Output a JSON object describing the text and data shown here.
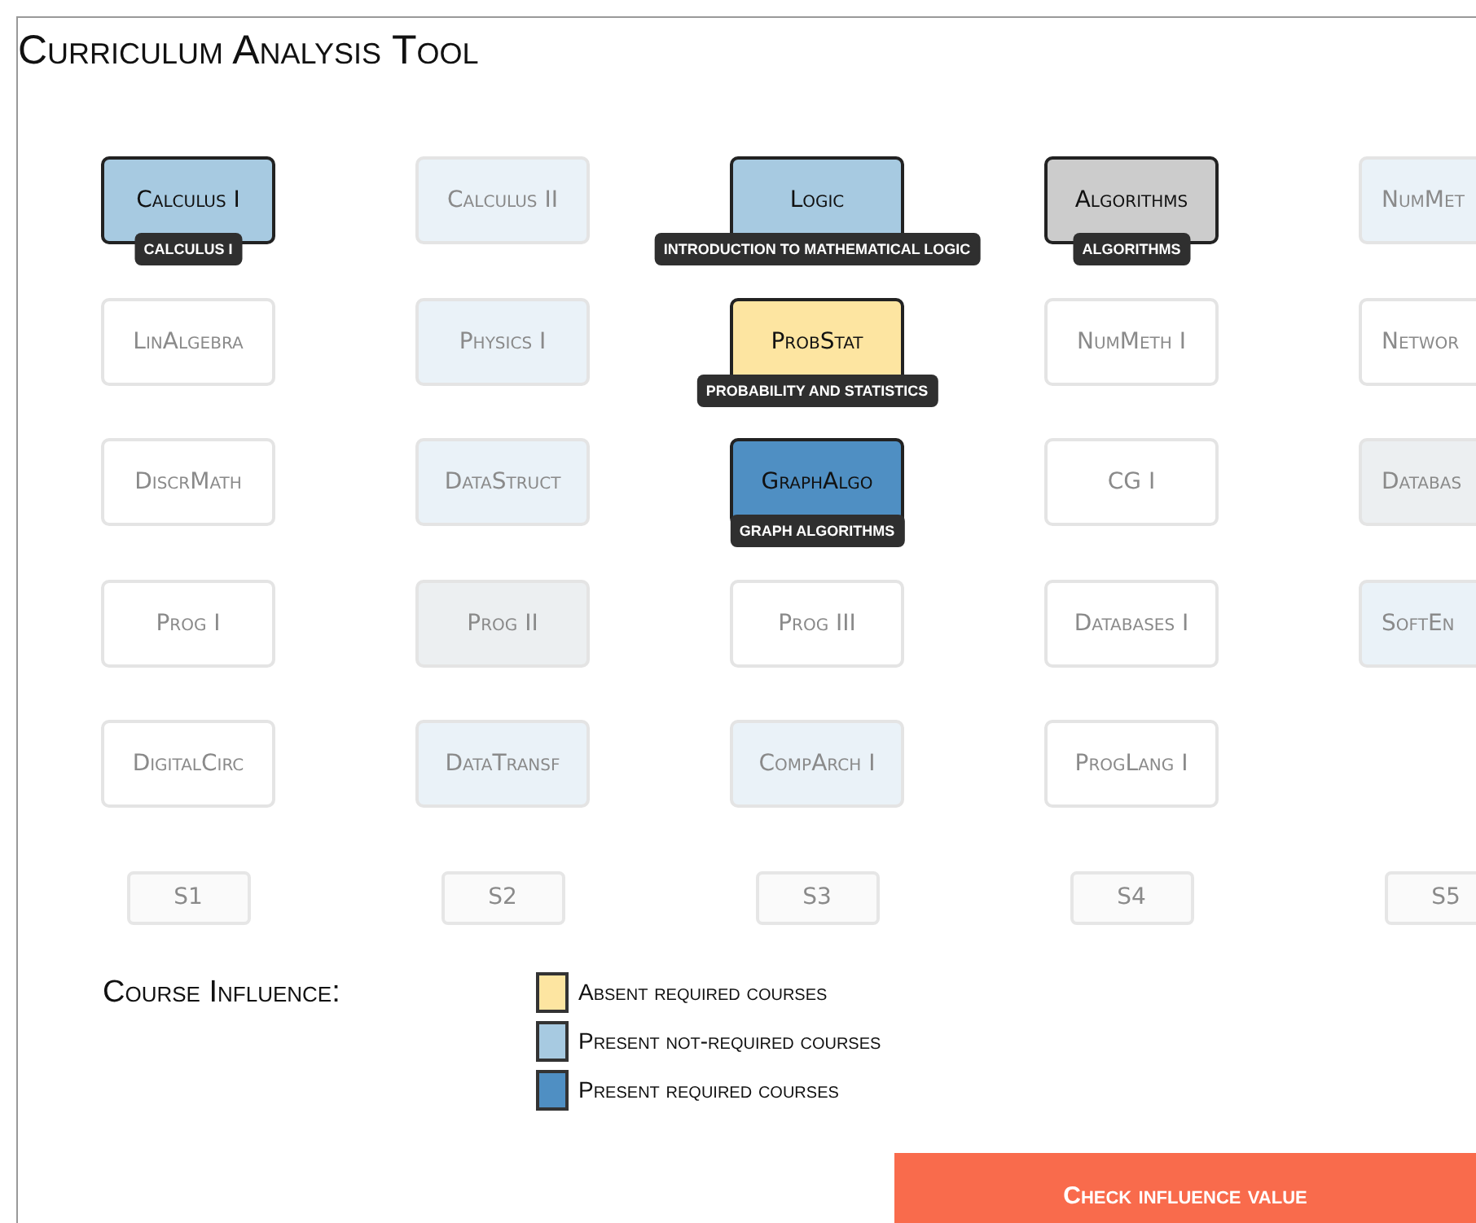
{
  "title": "Curriculum Analysis Tool",
  "rows": [
    [
      {
        "name": "Calculus I",
        "kind": "present_not_required",
        "faded": false,
        "tooltip": "CALCULUS I"
      },
      {
        "name": "Calculus II",
        "kind": "present_not_required",
        "faded": true
      },
      {
        "name": "Logic",
        "kind": "present_not_required",
        "faded": false,
        "tooltip": "INTRODUCTION TO MATHEMATICAL LOGIC"
      },
      {
        "name": "Algorithms",
        "kind": "target",
        "faded": false,
        "tooltip": "ALGORITHMS"
      },
      {
        "name": "NumMet",
        "kind": "present_not_required",
        "faded": true
      }
    ],
    [
      {
        "name": "LinAlgebra",
        "kind": "plain",
        "faded": true
      },
      {
        "name": "Physics I",
        "kind": "present_not_required",
        "faded": true
      },
      {
        "name": "ProbStat",
        "kind": "absent_required",
        "faded": false,
        "tooltip": "PROBABILITY AND STATISTICS"
      },
      {
        "name": "NumMeth I",
        "kind": "plain",
        "faded": true
      },
      {
        "name": "Networ",
        "kind": "plain",
        "faded": true
      }
    ],
    [
      {
        "name": "DiscrMath",
        "kind": "plain",
        "faded": true
      },
      {
        "name": "DataStruct",
        "kind": "present_not_required",
        "faded": true
      },
      {
        "name": "GraphAlgo",
        "kind": "present_required",
        "faded": false,
        "tooltip": "GRAPH ALGORITHMS"
      },
      {
        "name": "CG I",
        "kind": "plain",
        "faded": true
      },
      {
        "name": "Databas",
        "kind": "target",
        "faded": true
      }
    ],
    [
      {
        "name": "Prog I",
        "kind": "plain",
        "faded": true
      },
      {
        "name": "Prog II",
        "kind": "target",
        "faded": true
      },
      {
        "name": "Prog III",
        "kind": "plain",
        "faded": true
      },
      {
        "name": "Databases I",
        "kind": "plain",
        "faded": true
      },
      {
        "name": "SoftEn",
        "kind": "present_not_required",
        "faded": true
      }
    ],
    [
      {
        "name": "DigitalCirc",
        "kind": "plain",
        "faded": true
      },
      {
        "name": "DataTransf",
        "kind": "present_not_required",
        "faded": true
      },
      {
        "name": "CompArch I",
        "kind": "present_not_required",
        "faded": true
      },
      {
        "name": "ProgLang I",
        "kind": "plain",
        "faded": true
      },
      null
    ]
  ],
  "semesters": [
    "S1",
    "S2",
    "S3",
    "S4",
    "S5"
  ],
  "legend": {
    "title": "Course Influence:",
    "items": [
      {
        "label": "Absent required courses",
        "color": "#fde5a1"
      },
      {
        "label": "Present not-required courses",
        "color": "#a7cae1"
      },
      {
        "label": "Present required courses",
        "color": "#4f8fc3"
      }
    ]
  },
  "button": "Check influence value"
}
